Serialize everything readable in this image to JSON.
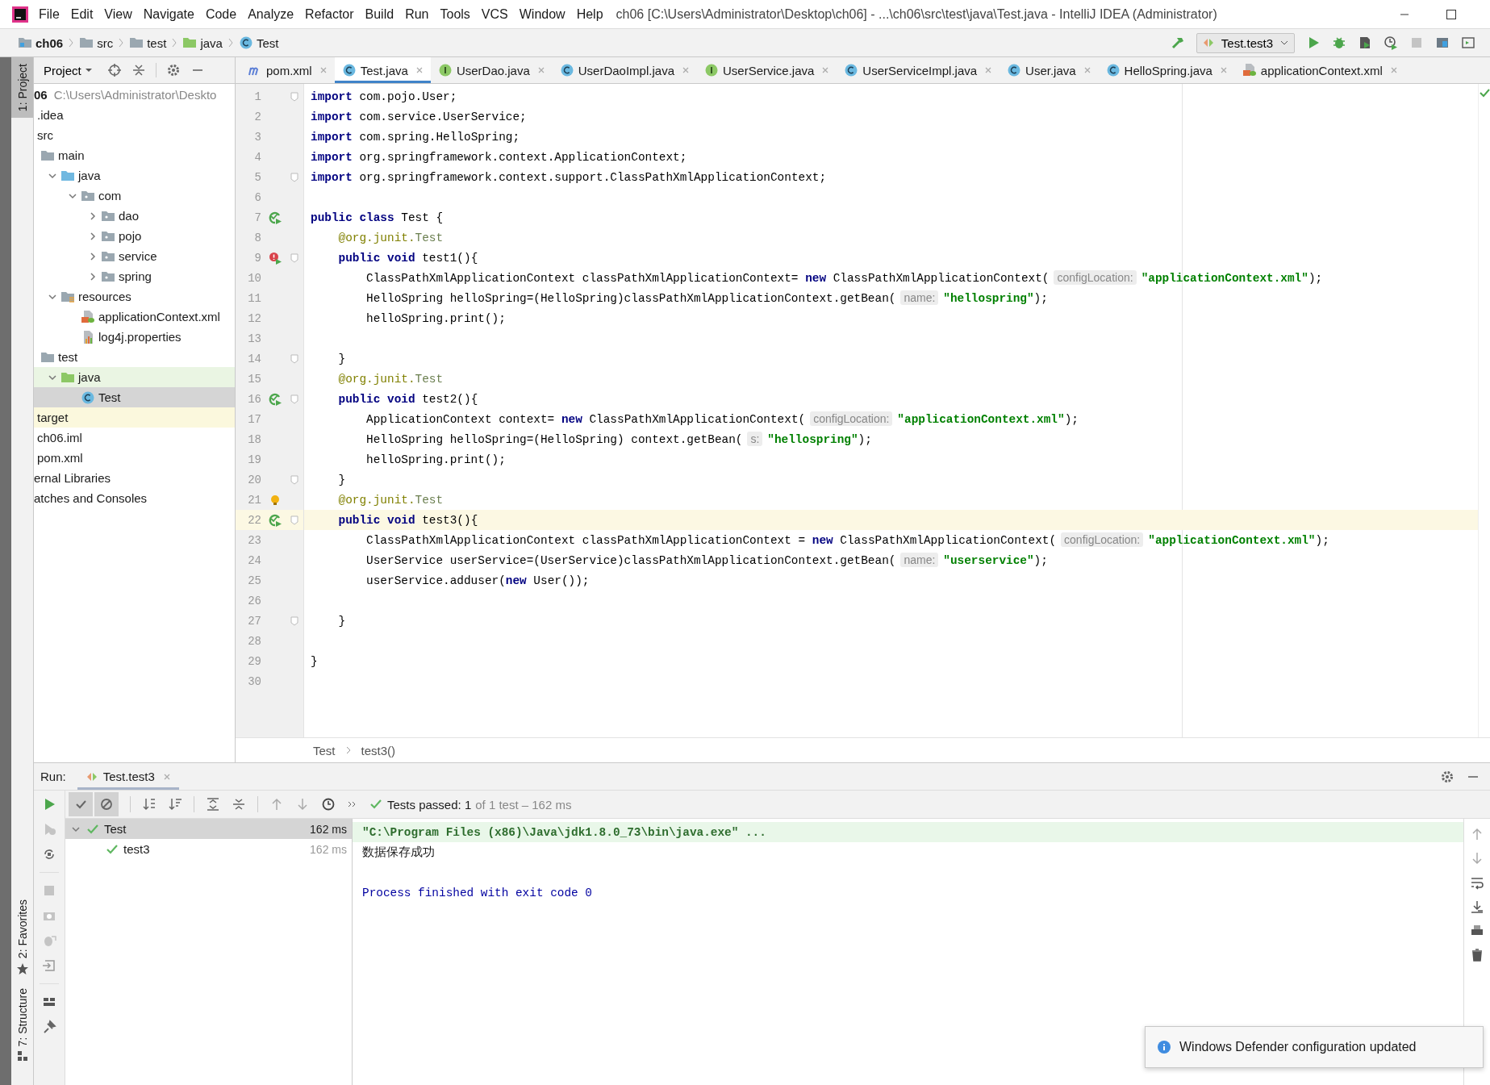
{
  "title_bar": {
    "menus": [
      "File",
      "Edit",
      "View",
      "Navigate",
      "Code",
      "Analyze",
      "Refactor",
      "Build",
      "Run",
      "Tools",
      "VCS",
      "Window",
      "Help"
    ],
    "title": "ch06 [C:\\Users\\Administrator\\Desktop\\ch06] - ...\\ch06\\src\\test\\java\\Test.java - IntelliJ IDEA (Administrator)"
  },
  "navigation_bar": {
    "breadcrumbs": [
      {
        "label": "ch06",
        "kind": "module"
      },
      {
        "label": "src",
        "kind": "folder"
      },
      {
        "label": "test",
        "kind": "folder"
      },
      {
        "label": "java",
        "kind": "test-folder"
      },
      {
        "label": "Test",
        "kind": "class"
      }
    ],
    "run_configuration": "Test.test3"
  },
  "tool_stripe": {
    "top": [
      {
        "label": "1: Project",
        "selected": true
      }
    ],
    "bottom": [
      {
        "label": "2: Favorites",
        "selected": false,
        "kind": "favorites"
      },
      {
        "label": "7: Structure",
        "selected": false,
        "kind": "structure"
      }
    ]
  },
  "project_panel": {
    "view": "Project",
    "tree": [
      {
        "label": "06",
        "detail": "C:\\Users\\Administrator\\Deskto",
        "selected": false,
        "children": [
          {
            "label": ".idea",
            "selected": false
          },
          {
            "label": "src",
            "selected": false,
            "children": [
              {
                "label": "main",
                "kind": "folder",
                "selected": false,
                "children": [
                  {
                    "label": "java",
                    "kind": "source-folder",
                    "expanded": true,
                    "selected": false,
                    "children": [
                      {
                        "label": "com",
                        "kind": "package",
                        "expanded": true,
                        "selected": false,
                        "children": [
                          {
                            "label": "dao",
                            "kind": "package",
                            "expanded": false,
                            "selected": false
                          },
                          {
                            "label": "pojo",
                            "kind": "package",
                            "expanded": false,
                            "selected": false
                          },
                          {
                            "label": "service",
                            "kind": "package",
                            "expanded": false,
                            "selected": false
                          },
                          {
                            "label": "spring",
                            "kind": "package",
                            "expanded": false,
                            "selected": false
                          }
                        ]
                      }
                    ]
                  },
                  {
                    "label": "resources",
                    "kind": "resources-folder",
                    "expanded": true,
                    "selected": false,
                    "children": [
                      {
                        "label": "applicationContext.xml",
                        "kind": "xml",
                        "selected": false
                      },
                      {
                        "label": "log4j.properties",
                        "kind": "properties",
                        "selected": false
                      }
                    ]
                  }
                ]
              },
              {
                "label": "test",
                "kind": "folder",
                "selected": false,
                "children": [
                  {
                    "label": "java",
                    "kind": "test-folder",
                    "expanded": true,
                    "selected": false,
                    "children": [
                      {
                        "label": "Test",
                        "kind": "class",
                        "selected": true
                      }
                    ]
                  }
                ]
              }
            ]
          },
          {
            "label": "target",
            "kind": "excluded-folder",
            "selected": false
          },
          {
            "label": "ch06.iml",
            "selected": false
          },
          {
            "label": "pom.xml",
            "selected": false
          }
        ]
      },
      {
        "label": "ernal Libraries",
        "selected": false
      },
      {
        "label": "atches and Consoles",
        "selected": false
      }
    ]
  },
  "editor": {
    "tabs": [
      {
        "label": "pom.xml",
        "kind": "maven",
        "selected": false
      },
      {
        "label": "Test.java",
        "kind": "class",
        "selected": true
      },
      {
        "label": "UserDao.java",
        "kind": "interface",
        "selected": false
      },
      {
        "label": "UserDaoImpl.java",
        "kind": "class",
        "selected": false
      },
      {
        "label": "UserService.java",
        "kind": "interface",
        "selected": false
      },
      {
        "label": "UserServiceImpl.java",
        "kind": "class",
        "selected": false
      },
      {
        "label": "User.java",
        "kind": "class",
        "selected": false
      },
      {
        "label": "HelloSpring.java",
        "kind": "class",
        "selected": false
      },
      {
        "label": "applicationContext.xml",
        "kind": "xml",
        "selected": false
      }
    ],
    "lines": [
      {
        "number": "1",
        "fold": true,
        "current": false,
        "tokens": [
          {
            "kind": "keyword",
            "text": "import"
          },
          {
            "kind": "plain",
            "text": " com.pojo.User;"
          }
        ]
      },
      {
        "number": "2",
        "fold": false,
        "current": false,
        "tokens": [
          {
            "kind": "keyword",
            "text": "import"
          },
          {
            "kind": "plain",
            "text": " com.service.UserService;"
          }
        ]
      },
      {
        "number": "3",
        "fold": false,
        "current": false,
        "tokens": [
          {
            "kind": "keyword",
            "text": "import"
          },
          {
            "kind": "plain",
            "text": " com.spring.HelloSpring;"
          }
        ]
      },
      {
        "number": "4",
        "fold": false,
        "current": false,
        "tokens": [
          {
            "kind": "keyword",
            "text": "import"
          },
          {
            "kind": "plain",
            "text": " org.springframework.context.ApplicationContext;"
          }
        ]
      },
      {
        "number": "5",
        "fold": true,
        "current": false,
        "tokens": [
          {
            "kind": "keyword",
            "text": "import"
          },
          {
            "kind": "plain",
            "text": " org.springframework.context.support.ClassPathXmlApplicationContext;"
          }
        ]
      },
      {
        "number": "6",
        "fold": false,
        "current": false
      },
      {
        "number": "7",
        "fold": false,
        "current": false,
        "gutter_mark": {
          "kind": "run"
        },
        "tokens": [
          {
            "kind": "keyword",
            "text": "public class"
          },
          {
            "kind": "plain",
            "text": " Test {"
          }
        ]
      },
      {
        "number": "8",
        "fold": false,
        "current": false,
        "tokens": [
          {
            "kind": "annotation",
            "text": "    @org.junit."
          },
          {
            "kind": "annotation-name",
            "text": "Test"
          }
        ]
      },
      {
        "number": "9",
        "fold": true,
        "current": false,
        "gutter_mark": {
          "kind": "run-error"
        },
        "tokens": [
          {
            "kind": "keyword",
            "text": "    public void"
          },
          {
            "kind": "plain",
            "text": " test1(){"
          }
        ]
      },
      {
        "number": "10",
        "fold": false,
        "current": false,
        "tokens": [
          {
            "kind": "plain",
            "text": "        ClassPathXmlApplicationContext classPathXmlApplicationContext= "
          },
          {
            "kind": "keyword",
            "text": "new"
          },
          {
            "kind": "plain",
            "text": " ClassPathXmlApplicationContext("
          },
          {
            "kind": "hint",
            "text": "configLocation:"
          },
          {
            "kind": "string",
            "text": "\"applicationContext.xml\""
          },
          {
            "kind": "plain",
            "text": ");"
          }
        ]
      },
      {
        "number": "11",
        "fold": false,
        "current": false,
        "tokens": [
          {
            "kind": "plain",
            "text": "        HelloSpring helloSpring=(HelloSpring)classPathXmlApplicationContext.getBean("
          },
          {
            "kind": "hint",
            "text": "name:"
          },
          {
            "kind": "string",
            "text": "\"hellospring\""
          },
          {
            "kind": "plain",
            "text": ");"
          }
        ]
      },
      {
        "number": "12",
        "fold": false,
        "current": false,
        "tokens": [
          {
            "kind": "plain",
            "text": "        helloSpring.print();"
          }
        ]
      },
      {
        "number": "13",
        "fold": false,
        "current": false
      },
      {
        "number": "14",
        "fold": true,
        "current": false,
        "tokens": [
          {
            "kind": "plain",
            "text": "    }"
          }
        ]
      },
      {
        "number": "15",
        "fold": false,
        "current": false,
        "tokens": [
          {
            "kind": "annotation",
            "text": "    @org.junit."
          },
          {
            "kind": "annotation-name",
            "text": "Test"
          }
        ]
      },
      {
        "number": "16",
        "fold": true,
        "current": false,
        "gutter_mark": {
          "kind": "run"
        },
        "tokens": [
          {
            "kind": "keyword",
            "text": "    public void"
          },
          {
            "kind": "plain",
            "text": " test2(){"
          }
        ]
      },
      {
        "number": "17",
        "fold": false,
        "current": false,
        "tokens": [
          {
            "kind": "plain",
            "text": "        ApplicationContext context= "
          },
          {
            "kind": "keyword",
            "text": "new"
          },
          {
            "kind": "plain",
            "text": " ClassPathXmlApplicationContext("
          },
          {
            "kind": "hint",
            "text": "configLocation:"
          },
          {
            "kind": "string",
            "text": "\"applicationContext.xml\""
          },
          {
            "kind": "plain",
            "text": ");"
          }
        ]
      },
      {
        "number": "18",
        "fold": false,
        "current": false,
        "tokens": [
          {
            "kind": "plain",
            "text": "        HelloSpring helloSpring=(HelloSpring) context.getBean("
          },
          {
            "kind": "hint",
            "text": "s:"
          },
          {
            "kind": "string",
            "text": "\"hellospring\""
          },
          {
            "kind": "plain",
            "text": ");"
          }
        ]
      },
      {
        "number": "19",
        "fold": false,
        "current": false,
        "tokens": [
          {
            "kind": "plain",
            "text": "        helloSpring.print();"
          }
        ]
      },
      {
        "number": "20",
        "fold": true,
        "current": false,
        "tokens": [
          {
            "kind": "plain",
            "text": "    }"
          }
        ]
      },
      {
        "number": "21",
        "fold": false,
        "current": false,
        "gutter_mark": {
          "kind": "bulb"
        },
        "tokens": [
          {
            "kind": "annotation",
            "text": "    @org.junit."
          },
          {
            "kind": "annotation-name",
            "text": "Test"
          }
        ]
      },
      {
        "number": "22",
        "fold": true,
        "current": true,
        "gutter_mark": {
          "kind": "run"
        },
        "tokens": [
          {
            "kind": "keyword",
            "text": "    public void"
          },
          {
            "kind": "plain",
            "text": " test3(){"
          }
        ]
      },
      {
        "number": "23",
        "fold": false,
        "current": false,
        "tokens": [
          {
            "kind": "plain",
            "text": "        ClassPathXmlApplicationContext classPathXmlApplicationContext = "
          },
          {
            "kind": "keyword",
            "text": "new"
          },
          {
            "kind": "plain",
            "text": " ClassPathXmlApplicationContext("
          },
          {
            "kind": "hint",
            "text": "configLocation:"
          },
          {
            "kind": "string",
            "text": "\"applicationContext.xml\""
          },
          {
            "kind": "plain",
            "text": ");"
          }
        ]
      },
      {
        "number": "24",
        "fold": false,
        "current": false,
        "tokens": [
          {
            "kind": "plain",
            "text": "        UserService userService=(UserService)classPathXmlApplicationContext.getBean("
          },
          {
            "kind": "hint",
            "text": "name:"
          },
          {
            "kind": "string",
            "text": "\"userservice\""
          },
          {
            "kind": "plain",
            "text": ");"
          }
        ]
      },
      {
        "number": "25",
        "fold": false,
        "current": false,
        "tokens": [
          {
            "kind": "plain",
            "text": "        userService.adduser("
          },
          {
            "kind": "keyword",
            "text": "new"
          },
          {
            "kind": "plain",
            "text": " User());"
          }
        ]
      },
      {
        "number": "26",
        "fold": false,
        "current": false
      },
      {
        "number": "27",
        "fold": true,
        "current": false,
        "tokens": [
          {
            "kind": "plain",
            "text": "    }"
          }
        ]
      },
      {
        "number": "28",
        "fold": false,
        "current": false
      },
      {
        "number": "29",
        "fold": false,
        "current": false,
        "tokens": [
          {
            "kind": "plain",
            "text": "}"
          }
        ]
      },
      {
        "number": "30",
        "fold": false,
        "current": false
      }
    ],
    "breadcrumbs": [
      "Test",
      "test3()"
    ]
  },
  "run_panel": {
    "label": "Run:",
    "tab": "Test.test3",
    "filters": [
      {
        "kind": "passed",
        "selected": true
      },
      {
        "kind": "ignored",
        "selected": true
      }
    ],
    "status": "Tests passed: 1",
    "status_detail": "of 1 test – 162 ms",
    "tests": [
      {
        "label": "Test",
        "duration": "162 ms",
        "passed": true,
        "expanded": true,
        "selected": true,
        "children": [
          {
            "label": "test3",
            "duration": "162 ms",
            "passed": true,
            "selected": false
          }
        ]
      }
    ],
    "console": [
      {
        "kind": "command",
        "text": "\"C:\\Program Files (x86)\\Java\\jdk1.8.0_73\\bin\\java.exe\" ..."
      },
      {
        "kind": "output",
        "text": "数据保存成功"
      },
      {
        "kind": "system",
        "text": "Process finished with exit code 0"
      }
    ]
  },
  "notification": {
    "text": "Windows Defender configuration updated"
  }
}
